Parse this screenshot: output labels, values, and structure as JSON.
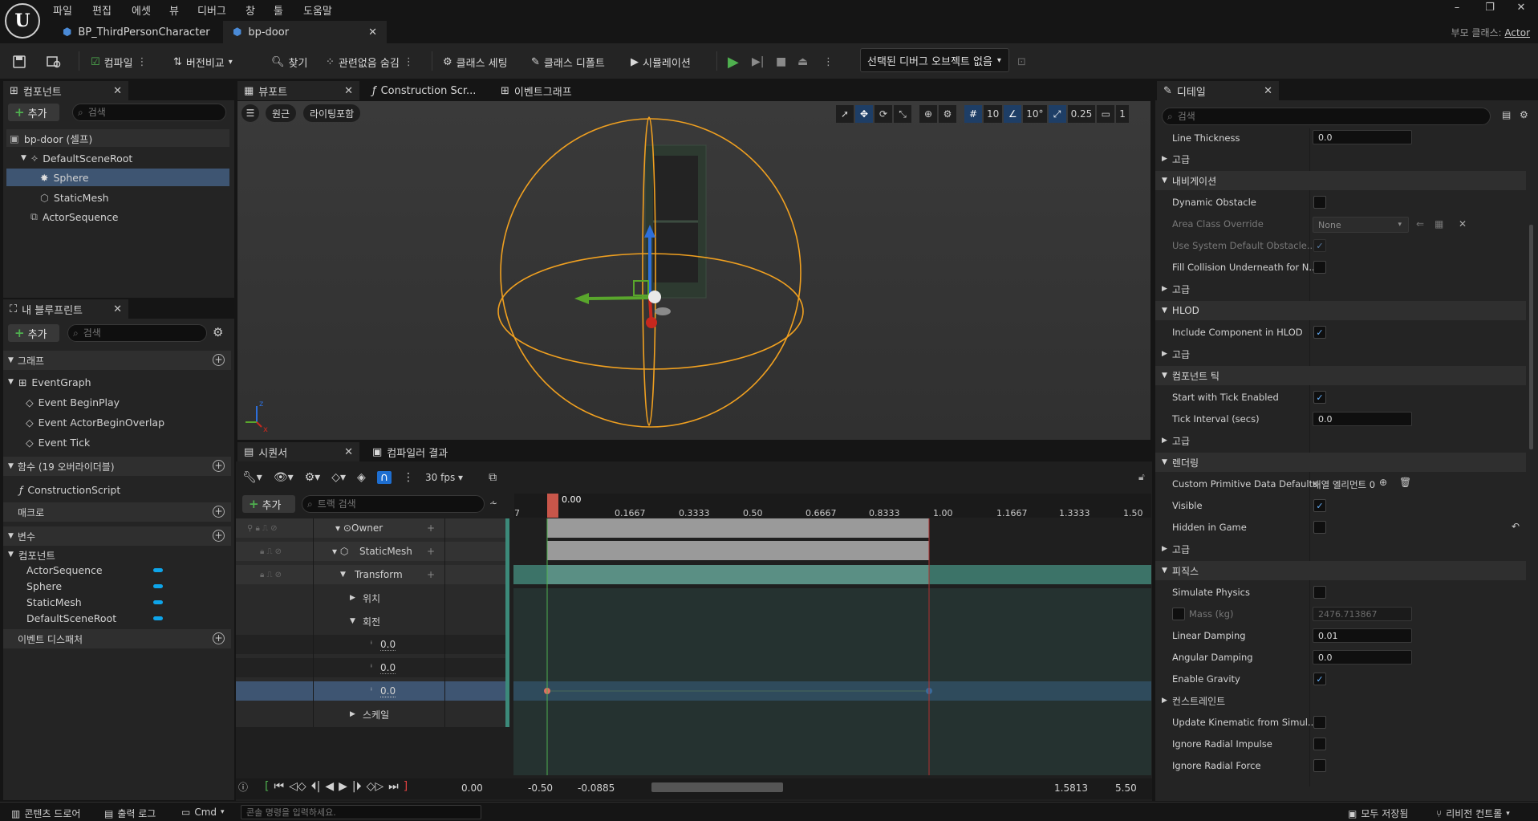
{
  "menu": [
    "파일",
    "편집",
    "에셋",
    "뷰",
    "디버그",
    "창",
    "툴",
    "도움말"
  ],
  "tabs": {
    "tab1": "BP_ThirdPersonCharacter",
    "tab2": "bp-door"
  },
  "parent_class": {
    "label": "부모 클래스:",
    "value": "Actor"
  },
  "toolbar": {
    "compile": "컴파일",
    "diff": "버전비교",
    "find": "찾기",
    "hide_unrelated": "관련없음 숨김",
    "class_settings": "클래스 세팅",
    "class_defaults": "클래스 디폴트",
    "simulation": "시뮬레이션",
    "debug_object": "선택된 디버그 오브젝트 없음"
  },
  "components": {
    "tab": "컴포넌트",
    "add": "추가",
    "search_placeholder": "검색",
    "items": [
      "bp-door (셀프)",
      "DefaultSceneRoot",
      "Sphere",
      "StaticMesh",
      "ActorSequence"
    ]
  },
  "my_blueprint": {
    "tab": "내 블루프린트",
    "add": "추가",
    "search_placeholder": "검색",
    "graphs_header": "그래프",
    "event_graph": "EventGraph",
    "events": [
      "Event BeginPlay",
      "Event ActorBeginOverlap",
      "Event Tick"
    ],
    "functions_header": "함수 (19 오버라이더블)",
    "construction_script": "ConstructionScript",
    "macros_header": "매크로",
    "variables_header": "변수",
    "components_header": "컴포넌트",
    "component_vars": [
      "ActorSequence",
      "Sphere",
      "StaticMesh",
      "DefaultSceneRoot"
    ],
    "dispatchers_header": "이벤트 디스패처"
  },
  "viewport": {
    "tabs": [
      "뷰포트",
      "Construction Scr...",
      "이벤트그래프"
    ],
    "perspective": "원근",
    "lit": "라이팅포함",
    "grid_snap": "10",
    "rot_snap": "10°",
    "scale_snap": "0.25",
    "cam_speed": "1"
  },
  "sequencer": {
    "tab": "시퀀서",
    "compiler_tab": "컴파일러 결과",
    "fps": "30 fps",
    "add": "추가",
    "search_placeholder": "트랙 검색",
    "tracks": {
      "owner": "Owner",
      "staticmesh": "StaticMesh",
      "transform": "Transform",
      "location": "위치",
      "rotation": "회전",
      "scale": "스케일"
    },
    "values": [
      "0.0",
      "0.0",
      "0.0"
    ],
    "ruler": [
      "0.00",
      "0.1667",
      "0.3333",
      "0.50",
      "0.6667",
      "0.8333",
      "1.00",
      "1.1667",
      "1.3333",
      "1.50"
    ],
    "ruler_left": "7",
    "current_time": "0.00",
    "range_start": "-0.50",
    "range_view_start": "-0.0885",
    "range_view_end": "1.5813",
    "range_end": "5.50"
  },
  "details": {
    "tab": "디테일",
    "search_placeholder": "검색",
    "line_thickness_label": "Line Thickness",
    "line_thickness": "0.0",
    "advanced": "고급",
    "navigation": "내비게이션",
    "dynamic_obstacle": "Dynamic Obstacle",
    "area_class_override": "Area Class Override",
    "area_class_value": "None",
    "use_system_default": "Use System Default Obstacle...",
    "fill_collision": "Fill Collision Underneath for N...",
    "hlod": "HLOD",
    "include_hlod": "Include Component in HLOD",
    "component_tick": "컴포넌트 틱",
    "start_with_tick": "Start with Tick Enabled",
    "tick_interval_label": "Tick Interval (secs)",
    "tick_interval": "0.0",
    "rendering": "렌더링",
    "custom_primitive": "Custom Primitive Data Defaults",
    "array_elements": "배열 엘리먼트 0",
    "visible": "Visible",
    "hidden_in_game": "Hidden in Game",
    "physics": "피직스",
    "simulate_physics": "Simulate Physics",
    "mass_label": "Mass (kg)",
    "mass": "2476.713867",
    "linear_damping_label": "Linear Damping",
    "linear_damping": "0.01",
    "angular_damping_label": "Angular Damping",
    "angular_damping": "0.0",
    "enable_gravity": "Enable Gravity",
    "constraints": "컨스트레인트",
    "update_kinematic": "Update Kinematic from Simul...",
    "ignore_radial_impulse": "Ignore Radial Impulse",
    "ignore_radial_force": "Ignore Radial Force"
  },
  "status": {
    "content_drawer": "콘텐츠 드로어",
    "output_log": "출력 로그",
    "cmd": "Cmd",
    "console_placeholder": "콘솔 명령을 입력하세요.",
    "save_all": "모두 저장됨",
    "revision_control": "리비전 컨트롤"
  },
  "colors": {
    "accent": "#0ea5ea",
    "selection": "#3e5572",
    "sphere": "#f0a020",
    "play": "#4fb04f"
  }
}
